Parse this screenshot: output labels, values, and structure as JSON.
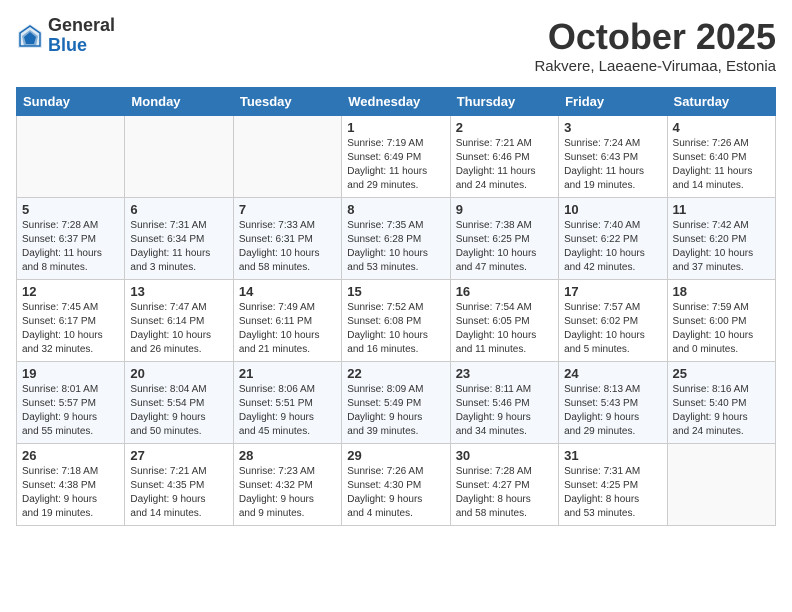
{
  "logo": {
    "general": "General",
    "blue": "Blue"
  },
  "title": "October 2025",
  "location": "Rakvere, Laeaene-Virumaa, Estonia",
  "weekdays": [
    "Sunday",
    "Monday",
    "Tuesday",
    "Wednesday",
    "Thursday",
    "Friday",
    "Saturday"
  ],
  "weeks": [
    [
      {
        "day": "",
        "info": ""
      },
      {
        "day": "",
        "info": ""
      },
      {
        "day": "",
        "info": ""
      },
      {
        "day": "1",
        "info": "Sunrise: 7:19 AM\nSunset: 6:49 PM\nDaylight: 11 hours\nand 29 minutes."
      },
      {
        "day": "2",
        "info": "Sunrise: 7:21 AM\nSunset: 6:46 PM\nDaylight: 11 hours\nand 24 minutes."
      },
      {
        "day": "3",
        "info": "Sunrise: 7:24 AM\nSunset: 6:43 PM\nDaylight: 11 hours\nand 19 minutes."
      },
      {
        "day": "4",
        "info": "Sunrise: 7:26 AM\nSunset: 6:40 PM\nDaylight: 11 hours\nand 14 minutes."
      }
    ],
    [
      {
        "day": "5",
        "info": "Sunrise: 7:28 AM\nSunset: 6:37 PM\nDaylight: 11 hours\nand 8 minutes."
      },
      {
        "day": "6",
        "info": "Sunrise: 7:31 AM\nSunset: 6:34 PM\nDaylight: 11 hours\nand 3 minutes."
      },
      {
        "day": "7",
        "info": "Sunrise: 7:33 AM\nSunset: 6:31 PM\nDaylight: 10 hours\nand 58 minutes."
      },
      {
        "day": "8",
        "info": "Sunrise: 7:35 AM\nSunset: 6:28 PM\nDaylight: 10 hours\nand 53 minutes."
      },
      {
        "day": "9",
        "info": "Sunrise: 7:38 AM\nSunset: 6:25 PM\nDaylight: 10 hours\nand 47 minutes."
      },
      {
        "day": "10",
        "info": "Sunrise: 7:40 AM\nSunset: 6:22 PM\nDaylight: 10 hours\nand 42 minutes."
      },
      {
        "day": "11",
        "info": "Sunrise: 7:42 AM\nSunset: 6:20 PM\nDaylight: 10 hours\nand 37 minutes."
      }
    ],
    [
      {
        "day": "12",
        "info": "Sunrise: 7:45 AM\nSunset: 6:17 PM\nDaylight: 10 hours\nand 32 minutes."
      },
      {
        "day": "13",
        "info": "Sunrise: 7:47 AM\nSunset: 6:14 PM\nDaylight: 10 hours\nand 26 minutes."
      },
      {
        "day": "14",
        "info": "Sunrise: 7:49 AM\nSunset: 6:11 PM\nDaylight: 10 hours\nand 21 minutes."
      },
      {
        "day": "15",
        "info": "Sunrise: 7:52 AM\nSunset: 6:08 PM\nDaylight: 10 hours\nand 16 minutes."
      },
      {
        "day": "16",
        "info": "Sunrise: 7:54 AM\nSunset: 6:05 PM\nDaylight: 10 hours\nand 11 minutes."
      },
      {
        "day": "17",
        "info": "Sunrise: 7:57 AM\nSunset: 6:02 PM\nDaylight: 10 hours\nand 5 minutes."
      },
      {
        "day": "18",
        "info": "Sunrise: 7:59 AM\nSunset: 6:00 PM\nDaylight: 10 hours\nand 0 minutes."
      }
    ],
    [
      {
        "day": "19",
        "info": "Sunrise: 8:01 AM\nSunset: 5:57 PM\nDaylight: 9 hours\nand 55 minutes."
      },
      {
        "day": "20",
        "info": "Sunrise: 8:04 AM\nSunset: 5:54 PM\nDaylight: 9 hours\nand 50 minutes."
      },
      {
        "day": "21",
        "info": "Sunrise: 8:06 AM\nSunset: 5:51 PM\nDaylight: 9 hours\nand 45 minutes."
      },
      {
        "day": "22",
        "info": "Sunrise: 8:09 AM\nSunset: 5:49 PM\nDaylight: 9 hours\nand 39 minutes."
      },
      {
        "day": "23",
        "info": "Sunrise: 8:11 AM\nSunset: 5:46 PM\nDaylight: 9 hours\nand 34 minutes."
      },
      {
        "day": "24",
        "info": "Sunrise: 8:13 AM\nSunset: 5:43 PM\nDaylight: 9 hours\nand 29 minutes."
      },
      {
        "day": "25",
        "info": "Sunrise: 8:16 AM\nSunset: 5:40 PM\nDaylight: 9 hours\nand 24 minutes."
      }
    ],
    [
      {
        "day": "26",
        "info": "Sunrise: 7:18 AM\nSunset: 4:38 PM\nDaylight: 9 hours\nand 19 minutes."
      },
      {
        "day": "27",
        "info": "Sunrise: 7:21 AM\nSunset: 4:35 PM\nDaylight: 9 hours\nand 14 minutes."
      },
      {
        "day": "28",
        "info": "Sunrise: 7:23 AM\nSunset: 4:32 PM\nDaylight: 9 hours\nand 9 minutes."
      },
      {
        "day": "29",
        "info": "Sunrise: 7:26 AM\nSunset: 4:30 PM\nDaylight: 9 hours\nand 4 minutes."
      },
      {
        "day": "30",
        "info": "Sunrise: 7:28 AM\nSunset: 4:27 PM\nDaylight: 8 hours\nand 58 minutes."
      },
      {
        "day": "31",
        "info": "Sunrise: 7:31 AM\nSunset: 4:25 PM\nDaylight: 8 hours\nand 53 minutes."
      },
      {
        "day": "",
        "info": ""
      }
    ]
  ]
}
